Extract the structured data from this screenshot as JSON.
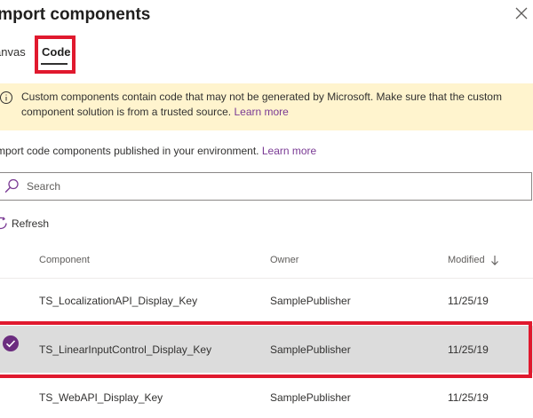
{
  "dialog": {
    "title": "Import components",
    "close_icon": "close-icon"
  },
  "tabs": [
    {
      "label": "Canvas",
      "visible_label": "anvas"
    },
    {
      "label": "Code",
      "selected": true
    }
  ],
  "banner": {
    "icon": "info-icon",
    "text": "Custom components contain code that may not be generated by Microsoft. Make sure that the custom component solution is from a trusted source.",
    "link": "Learn more",
    "color": "#fff4ce"
  },
  "intro": {
    "text": "mport code components published in your environment.",
    "link": "Learn more"
  },
  "search": {
    "placeholder": "Search",
    "value": "",
    "icon": "search-icon"
  },
  "toolbar": {
    "refresh_label": "Refresh",
    "refresh_icon": "refresh-icon"
  },
  "table": {
    "columns": [
      {
        "label": "Component"
      },
      {
        "label": "Owner"
      },
      {
        "label": "Modified",
        "sort": "descending"
      }
    ],
    "rows": [
      {
        "component": "TS_LocalizationAPI_Display_Key",
        "owner": "SamplePublisher",
        "modified": "11/25/19",
        "selected": false
      },
      {
        "component": "TS_LinearInputControl_Display_Key",
        "owner": "SamplePublisher",
        "modified": "11/25/19",
        "selected": true
      },
      {
        "component": "TS_WebAPI_Display_Key",
        "owner": "SamplePublisher",
        "modified": "11/25/19",
        "selected": false
      }
    ]
  },
  "colors": {
    "accent": "#7a3a94",
    "highlight": "#e0192e",
    "selected_row": "#dcdcdc"
  }
}
